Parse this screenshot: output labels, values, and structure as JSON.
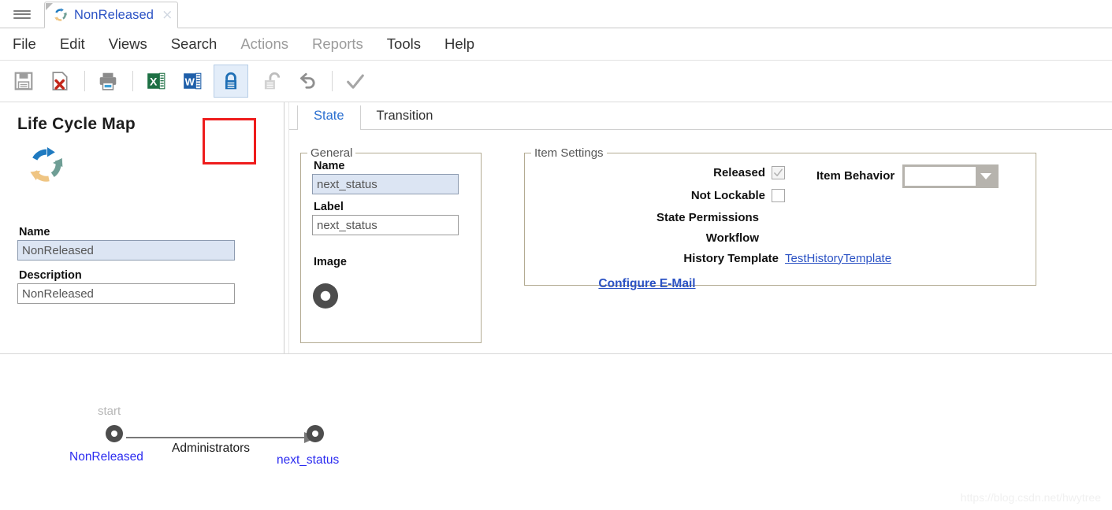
{
  "window": {
    "tab": {
      "title": "NonReleased",
      "icon": "lifecycle-circular-arrows-icon",
      "close": "×"
    },
    "hamburger_icon": "hamburger-menu-icon"
  },
  "menubar": {
    "items": [
      {
        "label": "File",
        "enabled": true
      },
      {
        "label": "Edit",
        "enabled": true
      },
      {
        "label": "Views",
        "enabled": true
      },
      {
        "label": "Search",
        "enabled": true
      },
      {
        "label": "Actions",
        "enabled": false
      },
      {
        "label": "Reports",
        "enabled": false
      },
      {
        "label": "Tools",
        "enabled": true
      },
      {
        "label": "Help",
        "enabled": true
      }
    ]
  },
  "toolbar": {
    "buttons": [
      {
        "name": "save-icon",
        "title": "Save"
      },
      {
        "name": "delete-icon",
        "title": "Delete"
      },
      {
        "name": "print-icon",
        "title": "Print"
      },
      {
        "name": "export-excel-icon",
        "title": "Export to Excel"
      },
      {
        "name": "export-word-icon",
        "title": "Export to Word"
      },
      {
        "name": "lock-icon",
        "title": "Lock"
      },
      {
        "name": "unlock-icon",
        "title": "Unlock"
      },
      {
        "name": "undo-icon",
        "title": "Undo"
      },
      {
        "name": "done-check-icon",
        "title": "Done"
      }
    ],
    "highlight_color": "#ee1c1c",
    "active_button": "lock-icon"
  },
  "left_panel": {
    "title": "Life Cycle Map",
    "icon": "lifecycle-circular-arrows-icon",
    "name_label": "Name",
    "name_value": "NonReleased",
    "description_label": "Description",
    "description_value": "NonReleased"
  },
  "right_panel": {
    "tabs": [
      {
        "label": "State",
        "active": true
      },
      {
        "label": "Transition",
        "active": false
      }
    ],
    "general": {
      "legend": "General",
      "name_label": "Name",
      "name_value": "next_status",
      "label_label": "Label",
      "label_value": "next_status",
      "image_label": "Image",
      "image_icon": "state-donut-icon"
    },
    "item_settings": {
      "legend": "Item Settings",
      "released_label": "Released",
      "released_checked": true,
      "not_lockable_label": "Not Lockable",
      "not_lockable_checked": false,
      "state_permissions_label": "State Permissions",
      "workflow_label": "Workflow",
      "history_template_label": "History Template",
      "history_template_value": "TestHistoryTemplate",
      "configure_email_label": "Configure E-Mail",
      "item_behavior_label": "Item Behavior",
      "item_behavior_value": ""
    }
  },
  "graph": {
    "start_label": "start",
    "node_from": "NonReleased",
    "node_to": "next_status",
    "edge_label": "Administrators"
  },
  "watermark": "https://blog.csdn.net/hwytree",
  "colors": {
    "link": "#2b52c4",
    "accent_blue": "#2b6fd0",
    "highlight_red": "#ee1c1c",
    "node_gray": "#4d4d4d",
    "field_focus": "#dce5f3"
  }
}
